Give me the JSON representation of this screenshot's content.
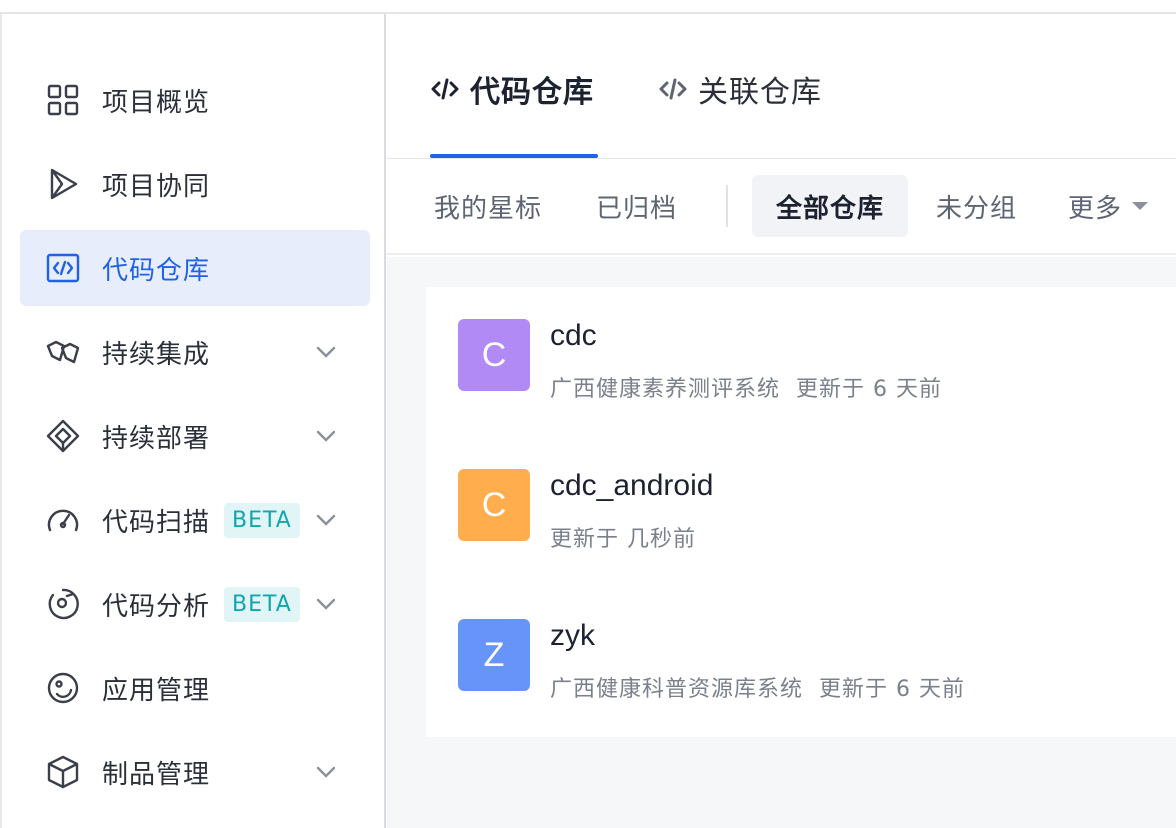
{
  "sidebar": {
    "items": [
      {
        "label": "项目概览",
        "icon": "grid-icon",
        "active": false,
        "chevron": false,
        "beta": ""
      },
      {
        "label": "项目协同",
        "icon": "play-triangle-icon",
        "active": false,
        "chevron": false,
        "beta": ""
      },
      {
        "label": "代码仓库",
        "icon": "code-box-icon",
        "active": true,
        "chevron": false,
        "beta": ""
      },
      {
        "label": "持续集成",
        "icon": "integration-icon",
        "active": false,
        "chevron": true,
        "beta": ""
      },
      {
        "label": "持续部署",
        "icon": "deploy-icon",
        "active": false,
        "chevron": true,
        "beta": ""
      },
      {
        "label": "代码扫描",
        "icon": "gauge-icon",
        "active": false,
        "chevron": true,
        "beta": "BETA"
      },
      {
        "label": "代码分析",
        "icon": "analysis-icon",
        "active": false,
        "chevron": true,
        "beta": "BETA"
      },
      {
        "label": "应用管理",
        "icon": "app-circle-icon",
        "active": false,
        "chevron": false,
        "beta": ""
      },
      {
        "label": "制品管理",
        "icon": "package-cube-icon",
        "active": false,
        "chevron": true,
        "beta": ""
      }
    ]
  },
  "tabs": [
    {
      "label": "代码仓库",
      "icon": "code-icon",
      "active": true
    },
    {
      "label": "关联仓库",
      "icon": "code-icon",
      "active": false
    }
  ],
  "filters": {
    "starred": "我的星标",
    "archived": "已归档",
    "all": "全部仓库",
    "ungrouped": "未分组",
    "more": "更多",
    "selected": "all"
  },
  "repos": [
    {
      "initial": "C",
      "name": "cdc",
      "description": "广西健康素养测评系统",
      "updated": "更新于 6 天前",
      "color": "#b18af5"
    },
    {
      "initial": "C",
      "name": "cdc_android",
      "description": "",
      "updated": "更新于 几秒前",
      "color": "#ffad4d"
    },
    {
      "initial": "Z",
      "name": "zyk",
      "description": "广西健康科普资源库系统",
      "updated": "更新于 6 天前",
      "color": "#6694f8"
    }
  ],
  "colors": {
    "accent": "#1f62e8",
    "beta_bg": "#e1f5f6",
    "beta_text": "#12a5ae"
  }
}
